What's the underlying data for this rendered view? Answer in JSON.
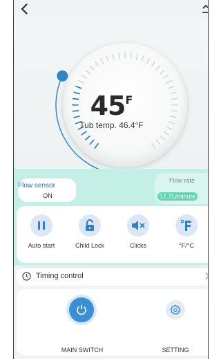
{
  "header": {
    "back_icon": "chevron-left-icon",
    "corner_icon": "upload-icon"
  },
  "dial": {
    "temperature_value": "45",
    "temperature_unit": "F",
    "tub_temp_label": "Tub temp. 46.4°F",
    "accent_color": "#2e86c9"
  },
  "flow_sensor": {
    "label": "Flow sensor",
    "value": "ON"
  },
  "flow_rate": {
    "label": "Flow rate",
    "value": "17.7L/minute"
  },
  "controls": [
    {
      "label": "Auto start",
      "icon": "pause-icon"
    },
    {
      "label": "Child Lock",
      "icon": "lock-icon"
    },
    {
      "label": "Clicks",
      "icon": "mute-icon"
    },
    {
      "label": "°F/°C",
      "icon": "fahrenheit-icon"
    }
  ],
  "timing": {
    "label": "Timing control",
    "icon": "clock-icon"
  },
  "bottom": {
    "main_switch_label": "MAIN SWITCH",
    "setting_label": "SETTING",
    "main_switch_color": "#3a8fd6"
  },
  "colors": {
    "teal_band": "#c4efe7",
    "flow_rate_badge": "#5ed6b0",
    "control_icon": "#2f7fd0"
  }
}
